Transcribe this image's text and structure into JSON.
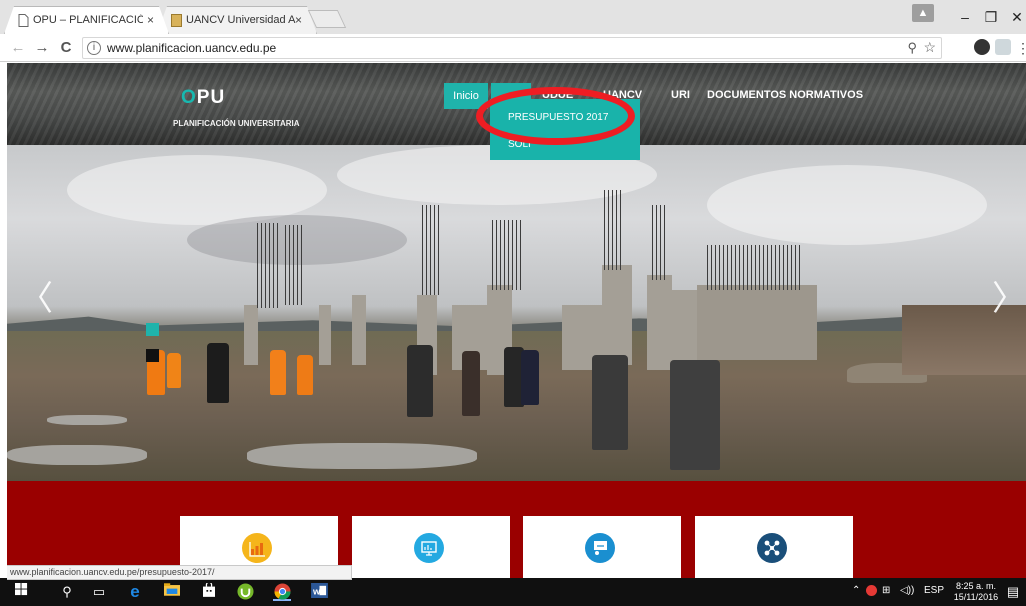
{
  "browser": {
    "tabs": [
      {
        "title": "OPU – PLANIFICACIÓN U",
        "close": "×",
        "favicon": "page-icon",
        "active": true
      },
      {
        "title": "UANCV Universidad And",
        "close": "×",
        "favicon": "university-logo-icon",
        "active": false
      }
    ],
    "url": "www.planificacion.uancv.edu.pe",
    "status_url": "www.planificacion.uancv.edu.pe/presupuesto-2017/",
    "window_controls": {
      "minimize": "–",
      "maximize": "❐",
      "close": "✕"
    },
    "nav": {
      "back": "←",
      "forward": "→",
      "reload": "C"
    }
  },
  "site": {
    "logo": {
      "accent": "O",
      "rest": "PU",
      "subtitle": "PLANIFICACIÓN UNIVERSITARIA"
    },
    "nav": {
      "home": "Inicio",
      "items": [
        "UDUE",
        "UANCV",
        "URI",
        "DOCUMENTOS NORMATIVOS"
      ]
    },
    "dropdown": {
      "items": [
        "PRESUPUESTO 2017",
        "SOLI"
      ]
    },
    "slider": {
      "prev": "〈",
      "next": "〉"
    },
    "cards": [
      {
        "icon": "bar-chart-icon",
        "color": "#f5b51b"
      },
      {
        "icon": "presentation-screen-icon",
        "color": "#24a9e1"
      },
      {
        "icon": "presenter-board-icon",
        "color": "#1a8fd0"
      },
      {
        "icon": "network-icon",
        "color": "#1a4f7a"
      }
    ]
  },
  "colors": {
    "accent": "#1fb3ab",
    "band": "#9a0000",
    "highlight": "#ee1d23"
  },
  "taskbar": {
    "language": "ESP",
    "time": "8:25 a. m.",
    "date": "15/11/2016"
  }
}
